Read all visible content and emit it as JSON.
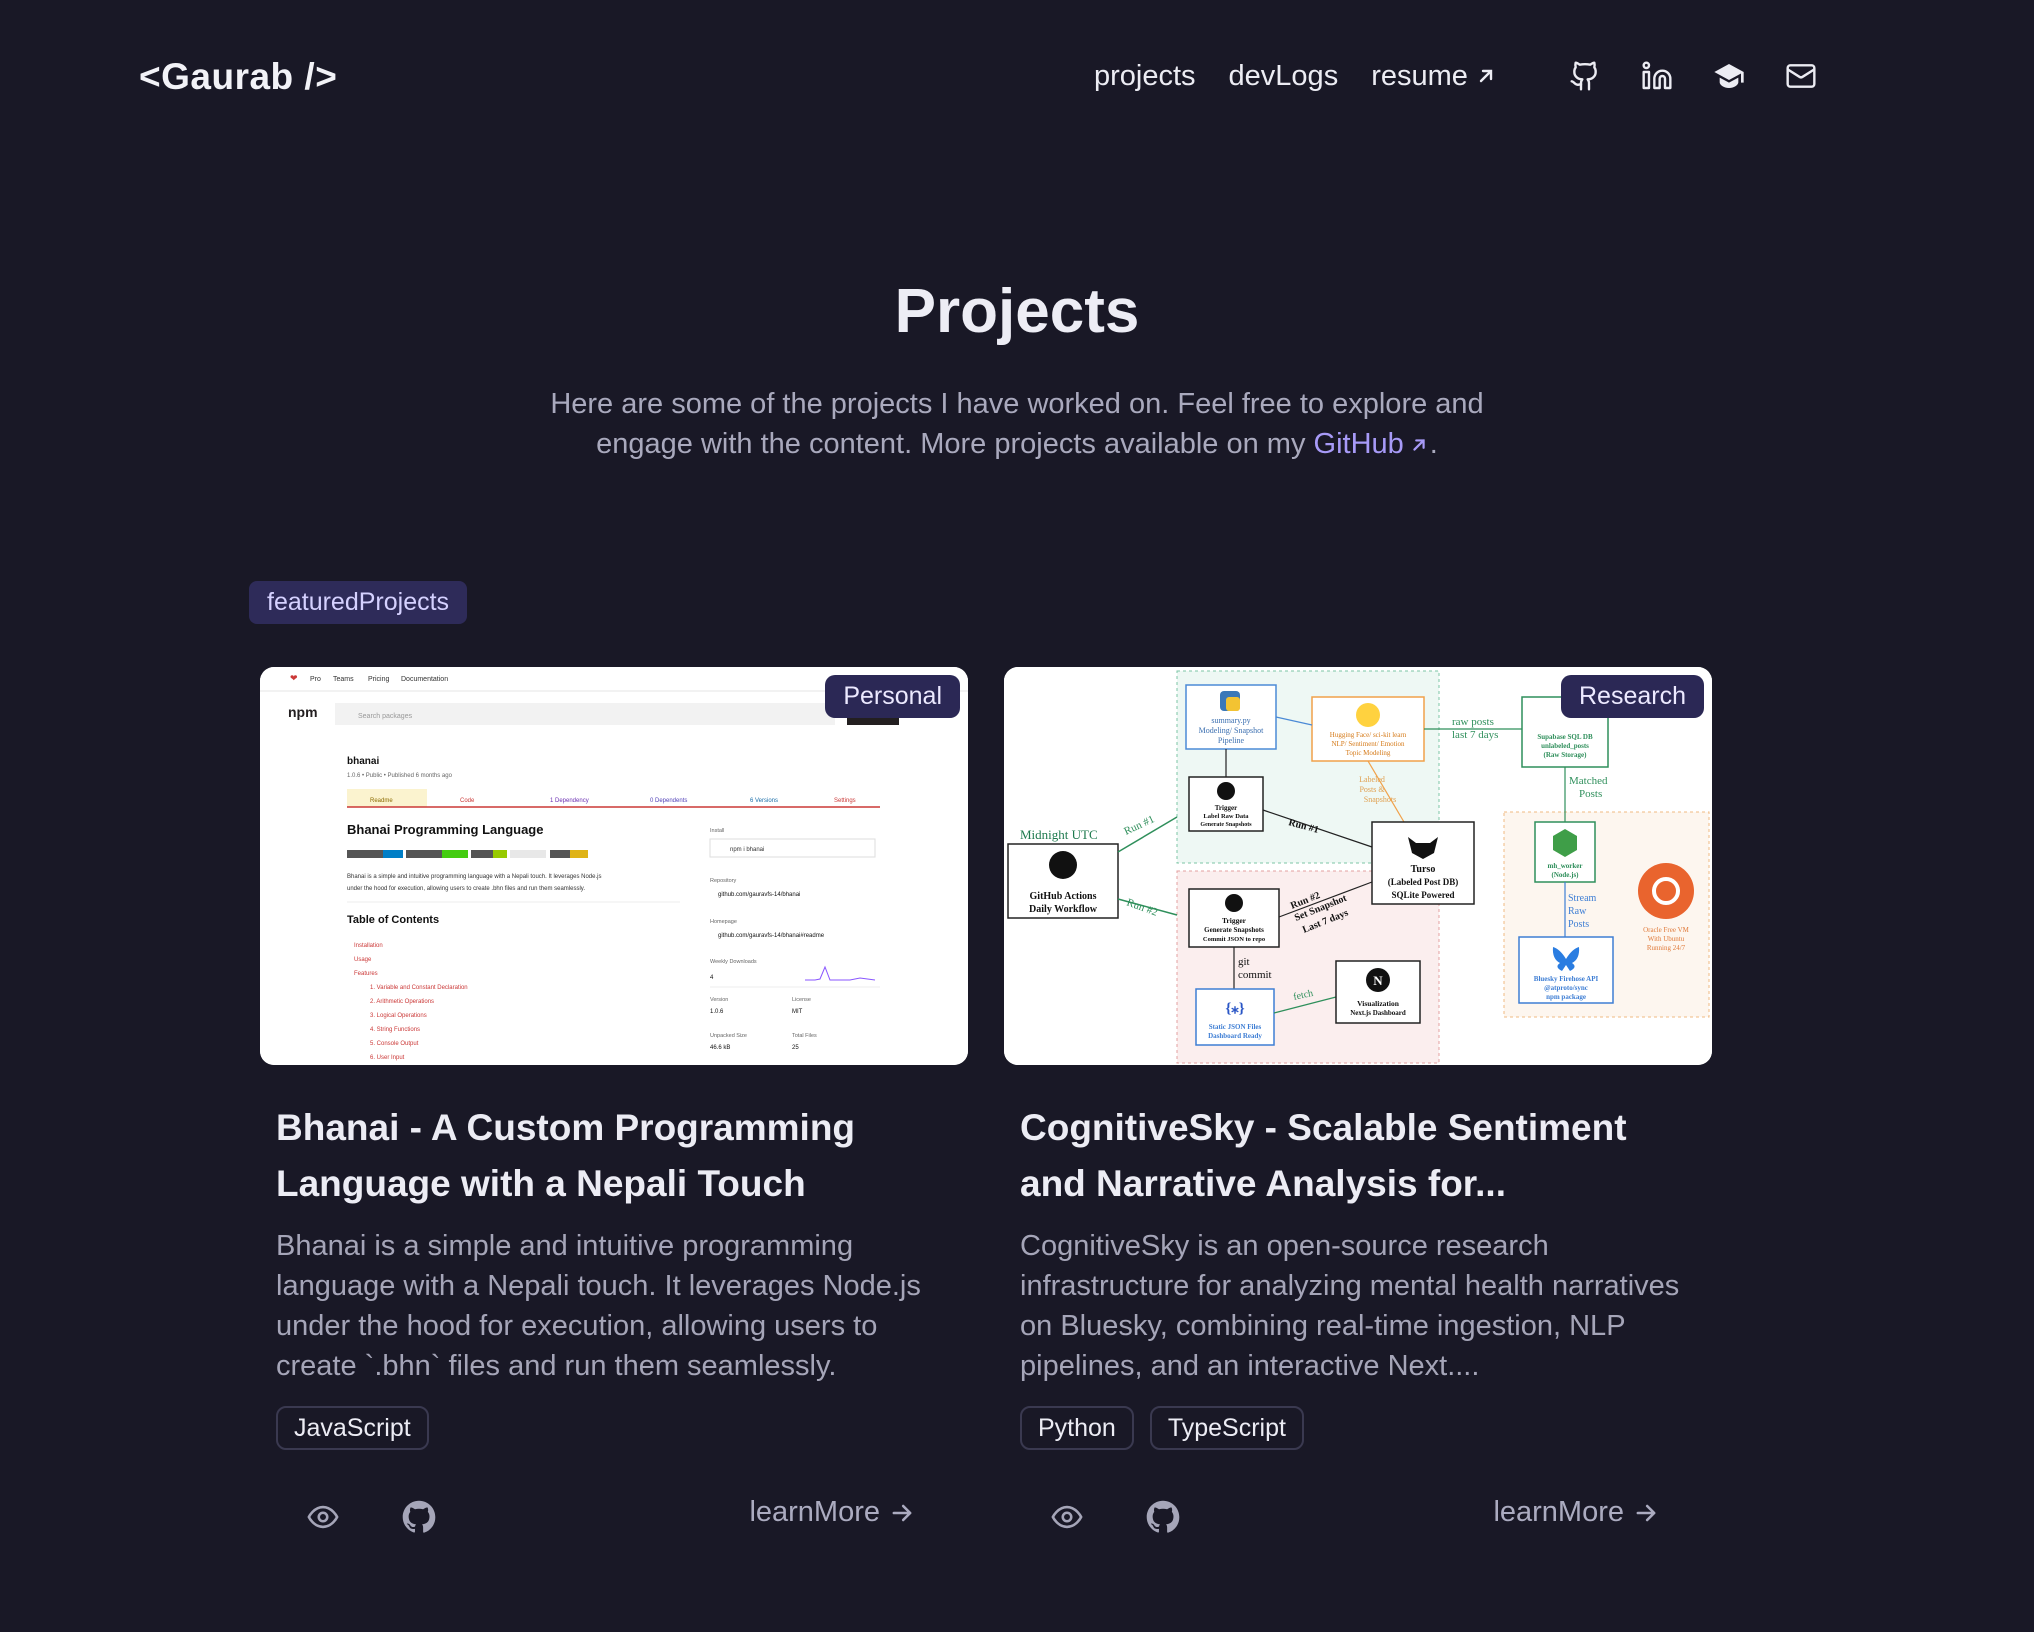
{
  "nav": {
    "logo": "<Gaurab />",
    "links": {
      "projects": "projects",
      "devlogs": "devLogs",
      "resume": "resume"
    },
    "icons": [
      "github-icon",
      "linkedin-icon",
      "graduation-cap-icon",
      "mail-icon"
    ]
  },
  "hero": {
    "title": "Projects",
    "subtitle_before": "Here are some of the projects I have worked on. Feel free to explore and engage with the content. More projects available on my ",
    "github_link": "GitHub",
    "subtitle_after": "."
  },
  "section": {
    "badge": "featuredProjects"
  },
  "projects": [
    {
      "badge": "Personal",
      "title": "Bhanai - A Custom Programming Language with a Nepali Touch",
      "description": "Bhanai is a simple and intuitive programming language with a Nepali touch. It leverages Node.js under the hood for execution, allowing users to create `.bhn` files and run them seamlessly.",
      "tags": [
        "JavaScript"
      ],
      "learn_more": "learnMore",
      "screenshot": {
        "top_links": [
          "Pro",
          "Teams",
          "Pricing",
          "Documentation"
        ],
        "brand": "npm",
        "search_placeholder": "Search packages",
        "package_name": "bhanai",
        "package_meta": "1.0.6 • Public • Published 6 months ago",
        "tabs": [
          "Readme",
          "Code",
          "1 Dependency",
          "0 Dependents",
          "6 Versions",
          "Settings"
        ],
        "heading": "Bhanai Programming Language",
        "body_line1": "Bhanai is a simple and intuitive programming language with a Nepali touch. It leverages Node.js",
        "body_line2": "under the hood for execution, allowing users to create .bhn files and run them seamlessly.",
        "toc_heading": "Table of Contents",
        "toc": [
          "Installation",
          "Usage",
          "Features",
          "1. Variable and Constant Declaration",
          "2. Arithmetic Operations",
          "3. Logical Operations",
          "4. String Functions",
          "5. Console Output",
          "6. User Input"
        ],
        "install_label": "Install",
        "install_cmd": "npm i bhanai",
        "repo_label": "Repository",
        "repo_value": "github.com/gauravfs-14/bhanai",
        "home_label": "Homepage",
        "home_value": "github.com/gauravfs-14/bhanai#readme",
        "downloads_label": "Weekly Downloads",
        "downloads_value": "4",
        "version_label": "Version",
        "version_value": "1.0.6",
        "license_label": "License",
        "license_value": "MIT",
        "size_label": "Unpacked Size",
        "size_value": "46.6 kB",
        "files_label": "Total Files",
        "files_value": "25"
      }
    },
    {
      "badge": "Research",
      "title": "CognitiveSky - Scalable Sentiment and Narrative Analysis for...",
      "description": "CognitiveSky is an open-source research infrastructure for analyzing mental health narratives on Bluesky, combining real-time ingestion, NLP pipelines, and an interactive Next....",
      "tags": [
        "Python",
        "TypeScript"
      ],
      "learn_more": "learnMore",
      "diagram": {
        "midnight": "Midnight UTC",
        "gha": [
          "GitHub Actions",
          "Daily Workflow"
        ],
        "run1": "Run #1",
        "run2": "Run #2",
        "summary": [
          "summary.py",
          "Modeling/ Snapshot",
          "Pipeline"
        ],
        "hf": [
          "Hugging Face/ sci-kit learn",
          "NLP/ Sentiment/ Emotion",
          "Topic Modeling"
        ],
        "trigger1": [
          "Trigger",
          "Label Raw Data",
          "Generate Snapshots"
        ],
        "labeled": [
          "Labeled",
          "Posts &",
          "Snapshots"
        ],
        "turso": [
          "Turso",
          "(Labeled Post DB)",
          "SQLite Powered"
        ],
        "raw_posts": [
          "raw posts",
          "last 7 days"
        ],
        "supabase": [
          "Supabase SQL DB",
          "unlabeled_posts",
          "(Raw Storage)"
        ],
        "matched": [
          "Matched",
          "Posts"
        ],
        "worker": [
          "mh_worker",
          "(Node.js)"
        ],
        "stream": [
          "Stream",
          "Raw",
          "Posts"
        ],
        "bluesky": [
          "Bluesky Firehose API",
          "@atproto/sync",
          "npm package"
        ],
        "oracle": [
          "Oracle Free VM",
          "With Ubuntu",
          "Running 24/7"
        ],
        "trigger2": [
          "Trigger",
          "Generate Snapshots",
          "Commit JSON to repo"
        ],
        "run2_label": [
          "Run #2",
          "Set Snapshot",
          "Last 7 days"
        ],
        "git": [
          "git",
          "commit"
        ],
        "static": [
          "Static JSON Files",
          "Dashboard Ready"
        ],
        "fetch": "fetch",
        "viz": [
          "Visualization",
          "Next.js Dashboard"
        ]
      }
    }
  ]
}
